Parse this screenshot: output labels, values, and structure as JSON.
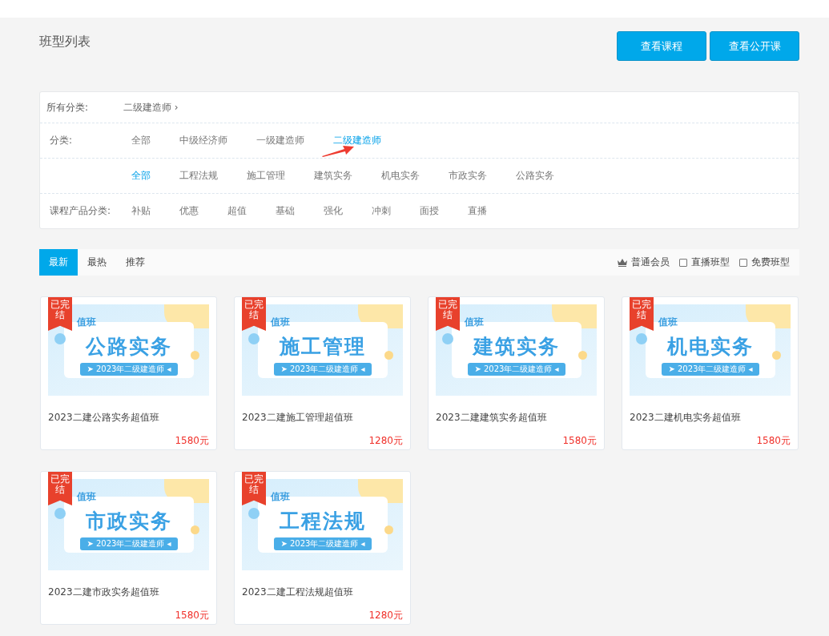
{
  "page_title": "班型列表",
  "header_buttons": [
    "查看课程",
    "查看公开课"
  ],
  "filters": {
    "breadcrumb": {
      "label": "所有分类:",
      "path": "二级建造师 ›"
    },
    "rows": [
      {
        "label": "分类:",
        "items": [
          {
            "text": "全部",
            "selected": false
          },
          {
            "text": "中级经济师",
            "selected": false
          },
          {
            "text": "一级建造师",
            "selected": false
          },
          {
            "text": "二级建造师",
            "selected": true
          }
        ],
        "pointer_arrow": true
      },
      {
        "items": [
          {
            "text": "全部",
            "selected": true
          },
          {
            "text": "工程法规",
            "selected": false
          },
          {
            "text": "施工管理",
            "selected": false
          },
          {
            "text": "建筑实务",
            "selected": false
          },
          {
            "text": "机电实务",
            "selected": false
          },
          {
            "text": "市政实务",
            "selected": false
          },
          {
            "text": "公路实务",
            "selected": false
          }
        ],
        "pointer_arrow": false
      },
      {
        "label": "课程产品分类:",
        "items": [
          {
            "text": "补贴",
            "selected": false
          },
          {
            "text": "优惠",
            "selected": false
          },
          {
            "text": "超值",
            "selected": false
          },
          {
            "text": "基础",
            "selected": false
          },
          {
            "text": "强化",
            "selected": false
          },
          {
            "text": "冲刺",
            "selected": false
          },
          {
            "text": "面授",
            "selected": false
          },
          {
            "text": "直播",
            "selected": false
          }
        ],
        "pointer_arrow": false
      }
    ]
  },
  "sort_tabs": [
    {
      "label": "最新",
      "selected": true
    },
    {
      "label": "最热",
      "selected": false
    },
    {
      "label": "推荐",
      "selected": false
    }
  ],
  "options": [
    {
      "kind": "member",
      "label": "普通会员"
    },
    {
      "kind": "checkbox",
      "label": "直播班型",
      "checked": false
    },
    {
      "kind": "checkbox",
      "label": "免费班型",
      "checked": false
    }
  ],
  "courses": [
    {
      "badge": "已完结",
      "banner": {
        "tag": "值班",
        "subject": "公路实务",
        "subtitle": "➤ 2023年二级建造师 ◂"
      },
      "title": "2023二建公路实务超值班",
      "price": "1580元"
    },
    {
      "badge": "已完结",
      "banner": {
        "tag": "值班",
        "subject": "施工管理",
        "subtitle": "➤ 2023年二级建造师 ◂"
      },
      "title": "2023二建施工管理超值班",
      "price": "1280元"
    },
    {
      "badge": "已完结",
      "banner": {
        "tag": "值班",
        "subject": "建筑实务",
        "subtitle": "➤ 2023年二级建造师 ◂"
      },
      "title": "2023二建建筑实务超值班",
      "price": "1580元"
    },
    {
      "badge": "已完结",
      "banner": {
        "tag": "值班",
        "subject": "机电实务",
        "subtitle": "➤ 2023年二级建造师 ◂"
      },
      "title": "2023二建机电实务超值班",
      "price": "1580元"
    },
    {
      "badge": "已完结",
      "banner": {
        "tag": "值班",
        "subject": "市政实务",
        "subtitle": "➤ 2023年二级建造师 ◂"
      },
      "title": "2023二建市政实务超值班",
      "price": "1580元"
    },
    {
      "badge": "已完结",
      "banner": {
        "tag": "值班",
        "subject": "工程法规",
        "subtitle": "➤ 2023年二级建造师 ◂"
      },
      "title": "2023二建工程法规超值班",
      "price": "1280元"
    }
  ]
}
